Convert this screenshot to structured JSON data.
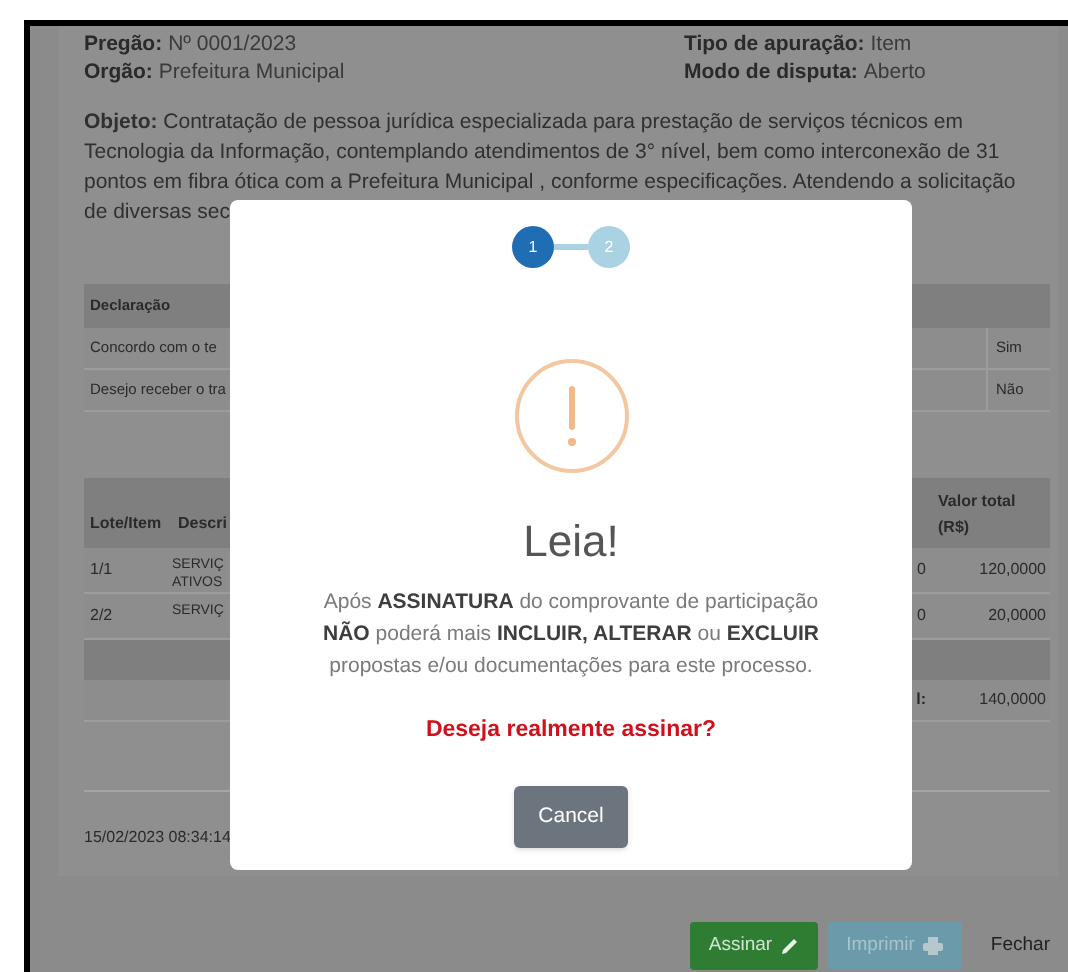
{
  "header": {
    "fields": [
      {
        "label": "Pregão:",
        "value": "Nº 0001/2023"
      },
      {
        "label": "Tipo de apuração:",
        "value": "Item"
      },
      {
        "label": "Orgão:",
        "value": "Prefeitura Municipal"
      },
      {
        "label": "Modo de disputa:",
        "value": "Aberto"
      }
    ]
  },
  "objeto": {
    "lines": [
      "**Objeto:** Contratação de pessoa jurídica especializada para prestação de serviços técnicos em",
      "Tecnologia da Informação, contemplando atendimentos de 3° nível, bem como interconexão de 31",
      "pontos em fibra ótica com a Prefeitura Municipal , conforme especificações. Atendendo a solicitação",
      "de diversas sec"
    ]
  },
  "declaracoes": {
    "heading": "Declaração",
    "rows": [
      {
        "text": "Concordo com o te",
        "answer": "Sim"
      },
      {
        "text": "Desejo receber o tra",
        "answer": "Não"
      }
    ]
  },
  "itens": {
    "columns": [
      "Lote/Item",
      "Descri",
      "Valor total (R$)"
    ],
    "rows": [
      {
        "lote": "1/1",
        "descricao": [
          "SERVIÇ",
          "ATIVOS"
        ],
        "column_3": "0",
        "total": "120,0000"
      },
      {
        "lote": "2/2",
        "descricao": [
          "SERVIÇ"
        ],
        "column_3": "0",
        "total": "20,0000"
      }
    ],
    "total": {
      "label": "l:",
      "value": "140,0000"
    }
  },
  "timestamp": "15/02/2023 08:34:14",
  "footer_buttons": [
    {
      "label": "Assinar",
      "kind": "sign",
      "disabled": false
    },
    {
      "label": "Imprimir",
      "kind": "print",
      "disabled": true
    },
    {
      "label": "Fechar",
      "kind": "close",
      "disabled": false
    }
  ],
  "dialog": {
    "steps": [
      {
        "label": "1",
        "selected": true
      },
      {
        "label": "2",
        "selected": false
      }
    ],
    "title": "Leia!",
    "message": [
      "Após **ASSINATURA** do comprovante de participação",
      "**NÃO** poderá mais **INCLUIR, ALTERAR** ou **EXCLUIR**",
      "propostas e/ou documentações para este processo."
    ],
    "question": "Deseja realmente assinar?",
    "cancel": "Cancel"
  }
}
